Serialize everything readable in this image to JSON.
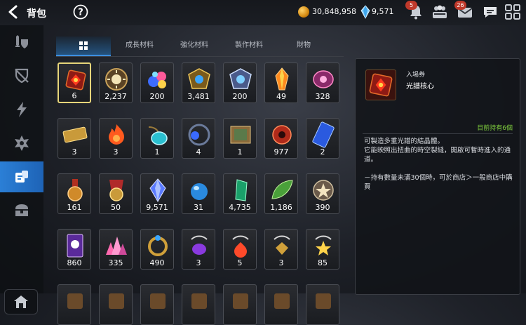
{
  "header": {
    "title": "背包",
    "gold": "30,848,958",
    "gems": "9,571",
    "bell_badge": "5",
    "mail_badge": "26"
  },
  "tabs": [
    "",
    "成長材料",
    "強化材料",
    "製作材料",
    "財物"
  ],
  "items": [
    {
      "icon": "red-cube-icon",
      "count": "6"
    },
    {
      "icon": "sun-emblem-icon",
      "count": "2,237"
    },
    {
      "icon": "gem-cluster-icon",
      "count": "200"
    },
    {
      "icon": "gold-crest-icon",
      "count": "3,481"
    },
    {
      "icon": "silver-crest-icon",
      "count": "200"
    },
    {
      "icon": "orange-crystal-icon",
      "count": "49"
    },
    {
      "icon": "pink-rune-stone-icon",
      "count": "328"
    },
    {
      "icon": "gold-ticket-icon",
      "count": "3"
    },
    {
      "icon": "fire-token-icon",
      "count": "3"
    },
    {
      "icon": "cyan-pendant-icon",
      "count": "1"
    },
    {
      "icon": "blue-pendant-icon",
      "count": "4"
    },
    {
      "icon": "map-scroll-icon",
      "count": "1"
    },
    {
      "icon": "red-orb-icon",
      "count": "977"
    },
    {
      "icon": "blue-ticket-icon",
      "count": "2"
    },
    {
      "icon": "bronze-medal-icon",
      "count": "161"
    },
    {
      "icon": "red-banner-medal-icon",
      "count": "50"
    },
    {
      "icon": "blue-crystal-icon",
      "count": "9,571"
    },
    {
      "icon": "blue-sphere-icon",
      "count": "31"
    },
    {
      "icon": "green-crystal-icon",
      "count": "4,735"
    },
    {
      "icon": "green-leaf-icon",
      "count": "1,186"
    },
    {
      "icon": "star-disc-icon",
      "count": "390"
    },
    {
      "icon": "purple-card-icon",
      "count": "860"
    },
    {
      "icon": "pink-crystal-pile-icon",
      "count": "335"
    },
    {
      "icon": "gold-ring-icon",
      "count": "490"
    },
    {
      "icon": "purple-pendant-icon",
      "count": "3"
    },
    {
      "icon": "red-pendant-icon",
      "count": "5"
    },
    {
      "icon": "gold-pendant-icon",
      "count": "3"
    },
    {
      "icon": "star-pendant-icon",
      "count": "85"
    },
    {
      "icon": "partial-item-icon",
      "count": ""
    },
    {
      "icon": "partial-item-icon",
      "count": ""
    },
    {
      "icon": "partial-item-icon",
      "count": ""
    },
    {
      "icon": "partial-item-icon",
      "count": ""
    },
    {
      "icon": "partial-item-icon",
      "count": ""
    },
    {
      "icon": "partial-item-icon",
      "count": ""
    },
    {
      "icon": "partial-item-icon",
      "count": ""
    }
  ],
  "detail": {
    "category": "入場券",
    "name": "光譜核心",
    "owned": "目前持有6個",
    "desc1": "可製造多重光譜的結晶體。\n它能映照出扭曲的時空裂縫，開啟可暫時進入的通道。",
    "desc2": "－持有數量未滿30個時，可於商店＞一般商店中購買"
  },
  "colors": {
    "accent": "#2b7fd6",
    "selected_border": "#e6d57a",
    "owned_text": "#7fcf3d"
  }
}
